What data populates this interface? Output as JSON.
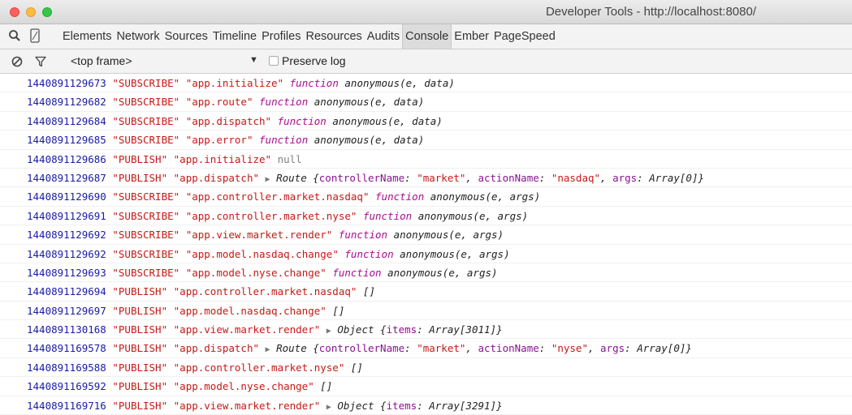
{
  "window": {
    "title": "Developer Tools - http://localhost:8080/"
  },
  "tabs": [
    {
      "label": "Elements"
    },
    {
      "label": "Network"
    },
    {
      "label": "Sources"
    },
    {
      "label": "Timeline"
    },
    {
      "label": "Profiles"
    },
    {
      "label": "Resources"
    },
    {
      "label": "Audits"
    },
    {
      "label": "Console"
    },
    {
      "label": "Ember"
    },
    {
      "label": "PageSpeed"
    }
  ],
  "active_tab": "Console",
  "console_toolbar": {
    "frame": "<top frame>",
    "preserve_log_label": "Preserve log",
    "preserve_log_checked": false
  },
  "rows": [
    {
      "ts": "1440891129673",
      "type": "\"SUBSCRIBE\"",
      "channel": "\"app.initialize\"",
      "fn": "function",
      "sig": "anonymous(e, data)"
    },
    {
      "ts": "1440891129682",
      "type": "\"SUBSCRIBE\"",
      "channel": "\"app.route\"",
      "fn": "function",
      "sig": "anonymous(e, data)"
    },
    {
      "ts": "1440891129684",
      "type": "\"SUBSCRIBE\"",
      "channel": "\"app.dispatch\"",
      "fn": "function",
      "sig": "anonymous(e, data)"
    },
    {
      "ts": "1440891129685",
      "type": "\"SUBSCRIBE\"",
      "channel": "\"app.error\"",
      "fn": "function",
      "sig": "anonymous(e, data)"
    },
    {
      "ts": "1440891129686",
      "type": "\"PUBLISH\"",
      "channel": "\"app.initialize\"",
      "nul": "null"
    },
    {
      "ts": "1440891129687",
      "type": "\"PUBLISH\"",
      "channel": "\"app.dispatch\"",
      "obj_prefix": "Route {",
      "kv": [
        [
          "controllerName",
          "\"market\""
        ],
        [
          "actionName",
          "\"nasdaq\""
        ],
        [
          "args",
          "Array[0]"
        ]
      ]
    },
    {
      "ts": "1440891129690",
      "type": "\"SUBSCRIBE\"",
      "channel": "\"app.controller.market.nasdaq\"",
      "fn": "function",
      "sig": "anonymous(e, args)"
    },
    {
      "ts": "1440891129691",
      "type": "\"SUBSCRIBE\"",
      "channel": "\"app.controller.market.nyse\"",
      "fn": "function",
      "sig": "anonymous(e, args)"
    },
    {
      "ts": "1440891129692",
      "type": "\"SUBSCRIBE\"",
      "channel": "\"app.view.market.render\"",
      "fn": "function",
      "sig": "anonymous(e, args)"
    },
    {
      "ts": "1440891129692",
      "type": "\"SUBSCRIBE\"",
      "channel": "\"app.model.nasdaq.change\"",
      "fn": "function",
      "sig": "anonymous(e, args)"
    },
    {
      "ts": "1440891129693",
      "type": "\"SUBSCRIBE\"",
      "channel": "\"app.model.nyse.change\"",
      "fn": "function",
      "sig": "anonymous(e, args)"
    },
    {
      "ts": "1440891129694",
      "type": "\"PUBLISH\"",
      "channel": "\"app.controller.market.nasdaq\"",
      "arr": "[]"
    },
    {
      "ts": "1440891129697",
      "type": "\"PUBLISH\"",
      "channel": "\"app.model.nasdaq.change\"",
      "arr": "[]"
    },
    {
      "ts": "1440891130168",
      "type": "\"PUBLISH\"",
      "channel": "\"app.view.market.render\"",
      "obj_prefix": "Object {",
      "kv": [
        [
          "items",
          "Array[3011]"
        ]
      ]
    },
    {
      "ts": "1440891169578",
      "type": "\"PUBLISH\"",
      "channel": "\"app.dispatch\"",
      "obj_prefix": "Route {",
      "kv": [
        [
          "controllerName",
          "\"market\""
        ],
        [
          "actionName",
          "\"nyse\""
        ],
        [
          "args",
          "Array[0]"
        ]
      ]
    },
    {
      "ts": "1440891169588",
      "type": "\"PUBLISH\"",
      "channel": "\"app.controller.market.nyse\"",
      "arr": "[]"
    },
    {
      "ts": "1440891169592",
      "type": "\"PUBLISH\"",
      "channel": "\"app.model.nyse.change\"",
      "arr": "[]"
    },
    {
      "ts": "1440891169716",
      "type": "\"PUBLISH\"",
      "channel": "\"app.view.market.render\"",
      "obj_prefix": "Object {",
      "kv": [
        [
          "items",
          "Array[3291]"
        ]
      ]
    }
  ]
}
